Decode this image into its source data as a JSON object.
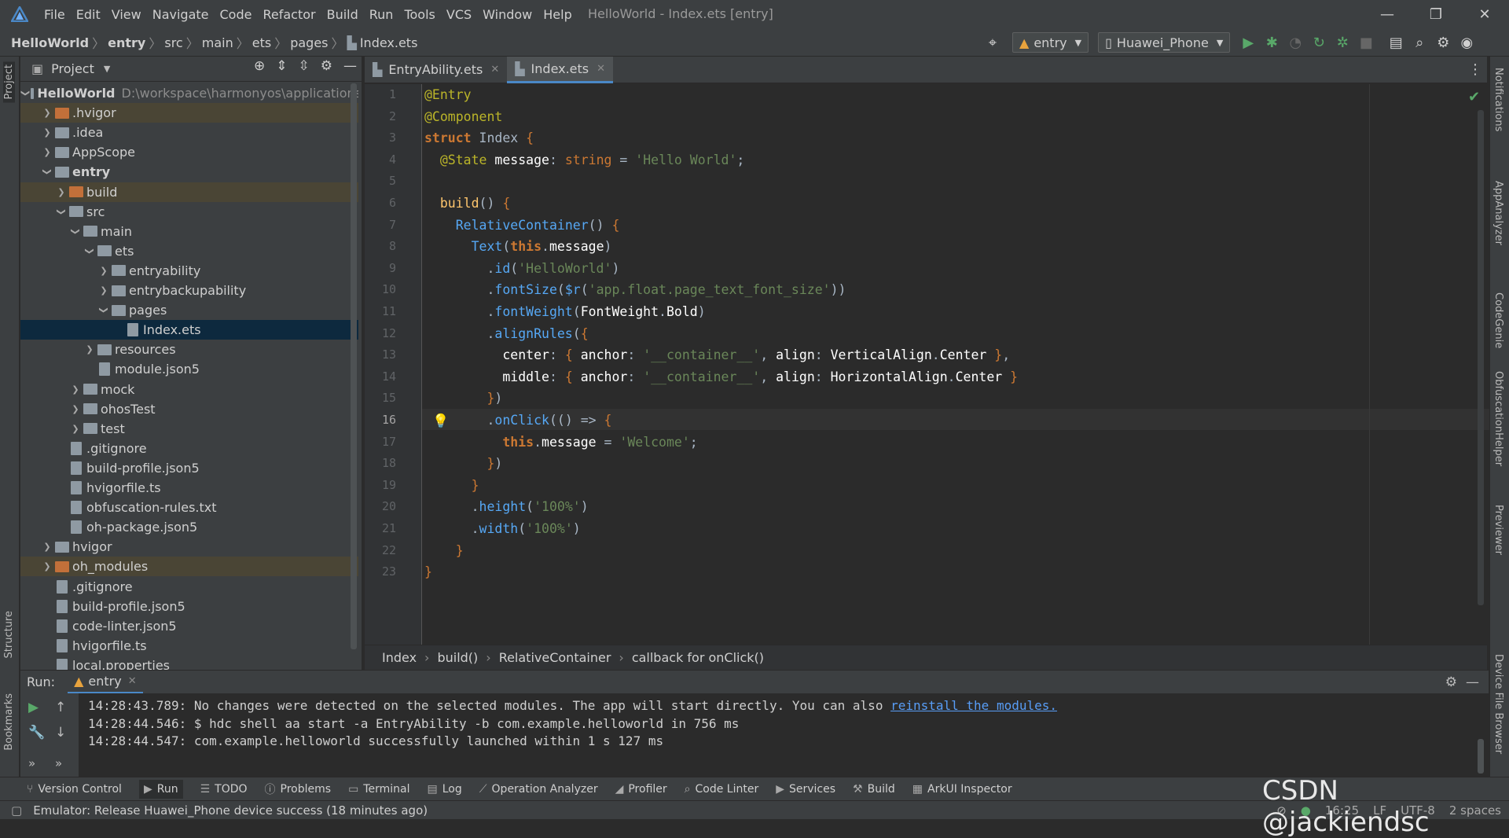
{
  "app": {
    "window_title": "HelloWorld - Index.ets [entry]",
    "menu": [
      "File",
      "Edit",
      "View",
      "Navigate",
      "Code",
      "Refactor",
      "Build",
      "Run",
      "Tools",
      "VCS",
      "Window",
      "Help"
    ]
  },
  "breadcrumb": [
    "HelloWorld",
    "entry",
    "src",
    "main",
    "ets",
    "pages",
    "Index.ets"
  ],
  "toolbar": {
    "module_combo": "entry",
    "device_combo": "Huawei_Phone"
  },
  "project": {
    "title": "Project",
    "tree": [
      {
        "label": "HelloWorld",
        "path": "D:\\workspace\\harmonyos\\applications",
        "depth": 0,
        "type": "folder",
        "open": true,
        "bold": true
      },
      {
        "label": ".hvigor",
        "depth": 1,
        "type": "folder-orange",
        "open": false
      },
      {
        "label": ".idea",
        "depth": 1,
        "type": "folder",
        "open": false
      },
      {
        "label": "AppScope",
        "depth": 1,
        "type": "folder",
        "open": false
      },
      {
        "label": "entry",
        "depth": 1,
        "type": "folder",
        "open": true,
        "bold": true
      },
      {
        "label": "build",
        "depth": 2,
        "type": "folder-orange",
        "open": false
      },
      {
        "label": "src",
        "depth": 2,
        "type": "folder",
        "open": true
      },
      {
        "label": "main",
        "depth": 3,
        "type": "folder",
        "open": true
      },
      {
        "label": "ets",
        "depth": 4,
        "type": "folder",
        "open": true
      },
      {
        "label": "entryability",
        "depth": 5,
        "type": "folder",
        "open": false
      },
      {
        "label": "entrybackupability",
        "depth": 5,
        "type": "folder",
        "open": false
      },
      {
        "label": "pages",
        "depth": 5,
        "type": "folder",
        "open": true
      },
      {
        "label": "Index.ets",
        "depth": 6,
        "type": "file",
        "selected": true
      },
      {
        "label": "resources",
        "depth": 4,
        "type": "folder",
        "open": false
      },
      {
        "label": "module.json5",
        "depth": 4,
        "type": "file"
      },
      {
        "label": "mock",
        "depth": 3,
        "type": "folder",
        "open": false
      },
      {
        "label": "ohosTest",
        "depth": 3,
        "type": "folder",
        "open": false
      },
      {
        "label": "test",
        "depth": 3,
        "type": "folder",
        "open": false
      },
      {
        "label": ".gitignore",
        "depth": 2,
        "type": "file"
      },
      {
        "label": "build-profile.json5",
        "depth": 2,
        "type": "file"
      },
      {
        "label": "hvigorfile.ts",
        "depth": 2,
        "type": "file"
      },
      {
        "label": "obfuscation-rules.txt",
        "depth": 2,
        "type": "file"
      },
      {
        "label": "oh-package.json5",
        "depth": 2,
        "type": "file"
      },
      {
        "label": "hvigor",
        "depth": 1,
        "type": "folder",
        "open": false
      },
      {
        "label": "oh_modules",
        "depth": 1,
        "type": "folder-orange",
        "open": false
      },
      {
        "label": ".gitignore",
        "depth": 1,
        "type": "file"
      },
      {
        "label": "build-profile.json5",
        "depth": 1,
        "type": "file"
      },
      {
        "label": "code-linter.json5",
        "depth": 1,
        "type": "file"
      },
      {
        "label": "hvigorfile.ts",
        "depth": 1,
        "type": "file"
      },
      {
        "label": "local.properties",
        "depth": 1,
        "type": "file"
      }
    ]
  },
  "editor": {
    "tabs": [
      {
        "label": "EntryAbility.ets",
        "active": false
      },
      {
        "label": "Index.ets",
        "active": true
      }
    ],
    "current_line": 16,
    "lines": [
      [
        [
          "an",
          "@Entry"
        ]
      ],
      [
        [
          "an",
          "@Component"
        ]
      ],
      [
        [
          "kw",
          "struct "
        ],
        [
          "tx",
          "Index "
        ],
        [
          "pu",
          "{"
        ]
      ],
      [
        [
          "tx",
          "  "
        ],
        [
          "an",
          "@State "
        ],
        [
          "nm",
          "message"
        ],
        [
          "tx",
          ": "
        ],
        [
          "ty",
          "string"
        ],
        [
          "tx",
          " = "
        ],
        [
          "st",
          "'Hello World'"
        ],
        [
          "tx",
          ";"
        ]
      ],
      [],
      [
        [
          "tx",
          "  "
        ],
        [
          "fn",
          "build"
        ],
        [
          "tx",
          "() "
        ],
        [
          "pu",
          "{"
        ]
      ],
      [
        [
          "tx",
          "    "
        ],
        [
          "cls",
          "RelativeContainer"
        ],
        [
          "tx",
          "() "
        ],
        [
          "pu",
          "{"
        ]
      ],
      [
        [
          "tx",
          "      "
        ],
        [
          "cls",
          "Text"
        ],
        [
          "tx",
          "("
        ],
        [
          "kw",
          "this"
        ],
        [
          "tx",
          "."
        ],
        [
          "nm",
          "message"
        ],
        [
          "tx",
          ")"
        ]
      ],
      [
        [
          "tx",
          "        ."
        ],
        [
          "cls",
          "id"
        ],
        [
          "tx",
          "("
        ],
        [
          "st",
          "'HelloWorld'"
        ],
        [
          "tx",
          ")"
        ]
      ],
      [
        [
          "tx",
          "        ."
        ],
        [
          "cls",
          "fontSize"
        ],
        [
          "tx",
          "("
        ],
        [
          "cls",
          "$r"
        ],
        [
          "tx",
          "("
        ],
        [
          "st",
          "'app.float.page_text_font_size'"
        ],
        [
          "tx",
          "))"
        ]
      ],
      [
        [
          "tx",
          "        ."
        ],
        [
          "cls",
          "fontWeight"
        ],
        [
          "tx",
          "("
        ],
        [
          "nm",
          "FontWeight"
        ],
        [
          "tx",
          "."
        ],
        [
          "nm",
          "Bold"
        ],
        [
          "tx",
          ")"
        ]
      ],
      [
        [
          "tx",
          "        ."
        ],
        [
          "cls",
          "alignRules"
        ],
        [
          "tx",
          "("
        ],
        [
          "pu",
          "{"
        ]
      ],
      [
        [
          "tx",
          "          "
        ],
        [
          "nm",
          "center"
        ],
        [
          "tx",
          ": "
        ],
        [
          "pu",
          "{ "
        ],
        [
          "nm",
          "anchor"
        ],
        [
          "tx",
          ": "
        ],
        [
          "st",
          "'__container__'"
        ],
        [
          "tx",
          ", "
        ],
        [
          "nm",
          "align"
        ],
        [
          "tx",
          ": "
        ],
        [
          "nm",
          "VerticalAlign"
        ],
        [
          "tx",
          "."
        ],
        [
          "nm",
          "Center "
        ],
        [
          "pu",
          "}"
        ],
        [
          "tx",
          ","
        ]
      ],
      [
        [
          "tx",
          "          "
        ],
        [
          "nm",
          "middle"
        ],
        [
          "tx",
          ": "
        ],
        [
          "pu",
          "{ "
        ],
        [
          "nm",
          "anchor"
        ],
        [
          "tx",
          ": "
        ],
        [
          "st",
          "'__container__'"
        ],
        [
          "tx",
          ", "
        ],
        [
          "nm",
          "align"
        ],
        [
          "tx",
          ": "
        ],
        [
          "nm",
          "HorizontalAlign"
        ],
        [
          "tx",
          "."
        ],
        [
          "nm",
          "Center "
        ],
        [
          "pu",
          "}"
        ]
      ],
      [
        [
          "tx",
          "        "
        ],
        [
          "pu",
          "}"
        ],
        [
          "tx",
          ")"
        ]
      ],
      [
        [
          "tx",
          "        ."
        ],
        [
          "cls",
          "onClick"
        ],
        [
          "tx",
          "(() => "
        ],
        [
          "pu",
          "{"
        ]
      ],
      [
        [
          "tx",
          "          "
        ],
        [
          "kw",
          "this"
        ],
        [
          "tx",
          "."
        ],
        [
          "nm",
          "message"
        ],
        [
          "tx",
          " = "
        ],
        [
          "st",
          "'Welcome'"
        ],
        [
          "tx",
          ";"
        ]
      ],
      [
        [
          "tx",
          "        "
        ],
        [
          "pu",
          "}"
        ],
        [
          "tx",
          ")"
        ]
      ],
      [
        [
          "tx",
          "      "
        ],
        [
          "pu",
          "}"
        ]
      ],
      [
        [
          "tx",
          "      ."
        ],
        [
          "cls",
          "height"
        ],
        [
          "tx",
          "("
        ],
        [
          "st",
          "'100%'"
        ],
        [
          "tx",
          ")"
        ]
      ],
      [
        [
          "tx",
          "      ."
        ],
        [
          "cls",
          "width"
        ],
        [
          "tx",
          "("
        ],
        [
          "st",
          "'100%'"
        ],
        [
          "tx",
          ")"
        ]
      ],
      [
        [
          "tx",
          "    "
        ],
        [
          "pu",
          "}"
        ]
      ],
      [
        [
          "pu",
          "}"
        ]
      ]
    ],
    "breadcrumb": [
      "Index",
      "build()",
      "RelativeContainer",
      "callback for onClick()"
    ]
  },
  "run": {
    "label": "Run:",
    "config": "entry",
    "output": [
      {
        "text": "14:28:43.789: No changes were detected on the selected modules. The app will start directly. You can also ",
        "link": "reinstall the modules."
      },
      {
        "text": "14:28:44.546: $ hdc shell aa start -a EntryAbility -b com.example.helloworld in 756 ms"
      },
      {
        "text": "14:28:44.547: com.example.helloworld successfully launched within 1 s 127 ms"
      }
    ]
  },
  "tool_windows": [
    {
      "label": "Version Control",
      "icon": "branch-icon"
    },
    {
      "label": "Run",
      "icon": "play-icon",
      "active": true
    },
    {
      "label": "TODO",
      "icon": "list-icon"
    },
    {
      "label": "Problems",
      "icon": "info-icon"
    },
    {
      "label": "Terminal",
      "icon": "terminal-icon"
    },
    {
      "label": "Log",
      "icon": "log-icon"
    },
    {
      "label": "Operation Analyzer",
      "icon": "chart-icon"
    },
    {
      "label": "Profiler",
      "icon": "profiler-icon"
    },
    {
      "label": "Code Linter",
      "icon": "linter-icon"
    },
    {
      "label": "Services",
      "icon": "services-icon"
    },
    {
      "label": "Build",
      "icon": "hammer-icon"
    },
    {
      "label": "ArkUI Inspector",
      "icon": "inspector-icon"
    }
  ],
  "side_strips": {
    "left": [
      "Project",
      "Structure",
      "Bookmarks"
    ],
    "right": [
      "Notifications",
      "AppAnalyzer",
      "CodeGenie",
      "ObfuscationHelper",
      "Previewer",
      "Device File Browser"
    ]
  },
  "status": {
    "message": "Emulator: Release Huawei_Phone device success (18 minutes ago)",
    "time": "16:25",
    "line_sep": "LF",
    "encoding": "UTF-8",
    "indent": "2 spaces"
  },
  "watermark": "CSDN @jackiendsc",
  "colors": {
    "accent": "#4a88c7",
    "selection": "#0d293e",
    "run_green": "#59a869"
  }
}
